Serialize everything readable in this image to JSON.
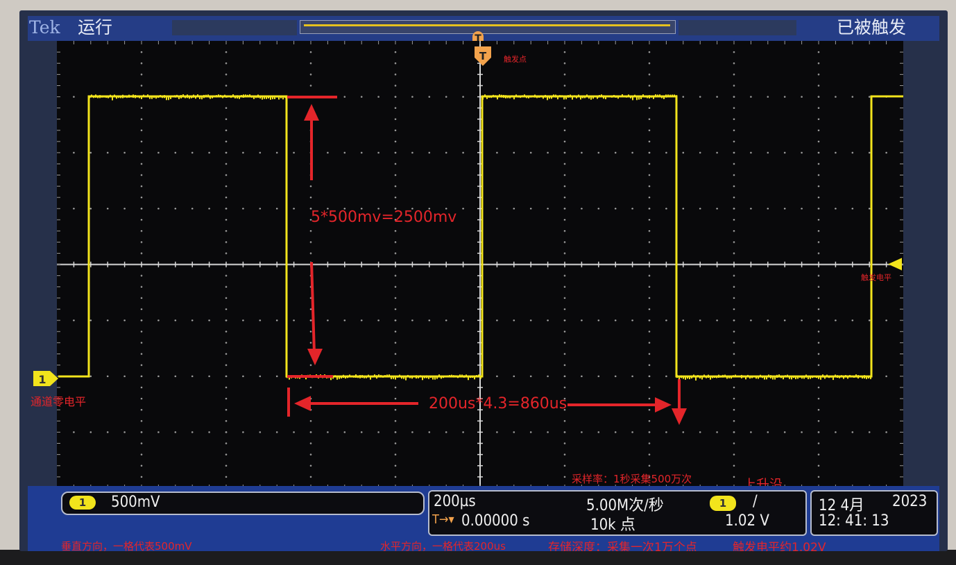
{
  "header": {
    "brand": "Tek",
    "run_status": "运行",
    "trigger_status": "已被触发"
  },
  "trigger_marker": "T",
  "trigger_position_marker": "T",
  "channel": {
    "number": "1",
    "scale": "500mV"
  },
  "timebase": {
    "scale": "200µs",
    "trigger_offset_icon": "T→▾",
    "trigger_offset": "0.00000 s",
    "sample_rate": "5.00M次/秒",
    "record_length": "10k 点"
  },
  "trigger": {
    "source": "1",
    "slope_icon": "/",
    "level": "1.02 V"
  },
  "datetime": {
    "date_day_month": "12 4月",
    "year": "2023",
    "time": "12: 41: 13"
  },
  "annotations": {
    "trigger_point": "触发点",
    "trigger_level": "触发电平",
    "channel_zero": "通道零电平",
    "amplitude_calc": "5*500mv=2500mv",
    "period_calc": "200us*4.3=860us",
    "sample_rate_note": "采样率：1秒采集500万次",
    "rising_edge": "上升沿",
    "vertical_note": "垂直方向，一格代表500mV",
    "horizontal_note": "水平方向，一格代表200us",
    "memory_depth_note": "存储深度：采集一次1万个点",
    "trigger_level_note": "触发电平约1.02V"
  },
  "colors": {
    "trace": "#f2e41c",
    "screen": "#09090b",
    "frame": "#253d86",
    "annotation": "#e4252a",
    "trigger_marker": "#f2a24c"
  }
}
